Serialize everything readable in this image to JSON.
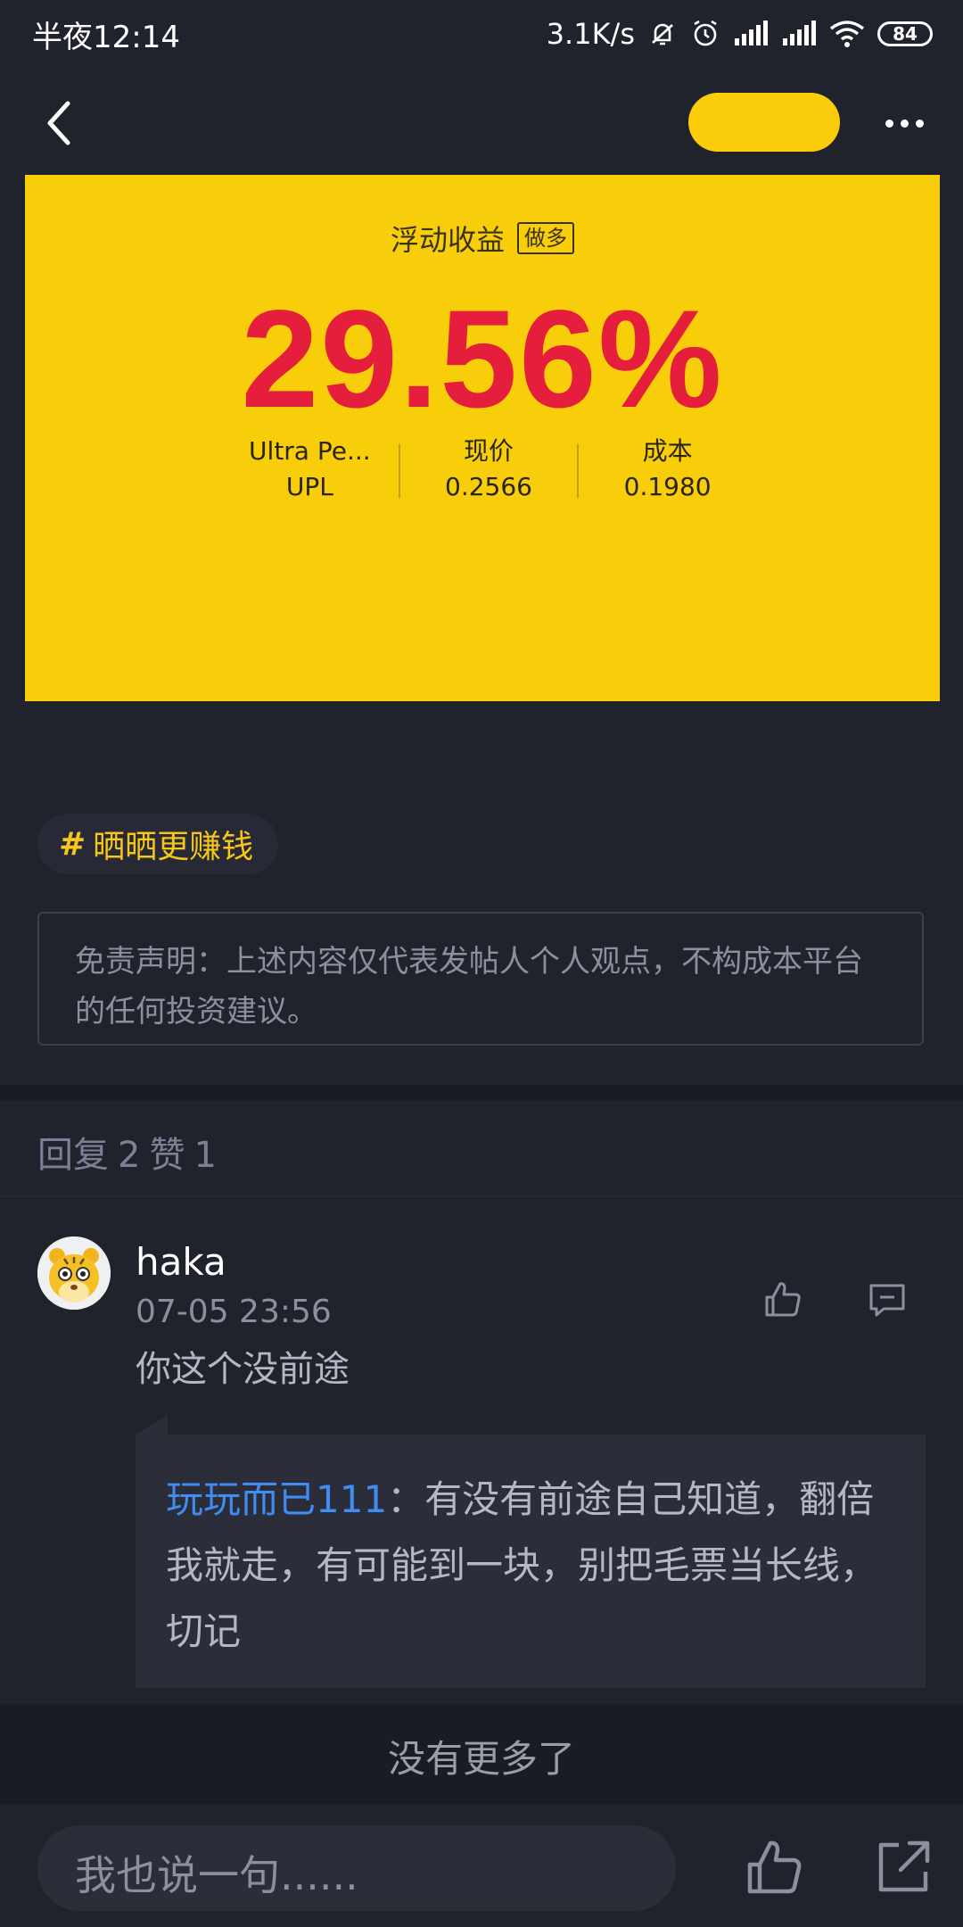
{
  "status_bar": {
    "time": "半夜12:14",
    "network_speed": "3.1K/s",
    "battery": "84"
  },
  "card": {
    "label": "浮动收益",
    "tag": "做多",
    "return_value": "29.56%",
    "stats": [
      {
        "line1": "Ultra Pe...",
        "line2": "UPL"
      },
      {
        "line1": "现价",
        "line2": "0.2566"
      },
      {
        "line1": "成本",
        "line2": "0.1980"
      }
    ]
  },
  "hashtag": {
    "symbol": "#",
    "text": "晒晒更赚钱"
  },
  "disclaimer": "免责声明：上述内容仅代表发帖人个人观点，不构成本平台的任何投资建议。",
  "post_stats": {
    "reply_label": "回复",
    "reply_count": "2",
    "like_label": "赞",
    "like_count": "1"
  },
  "comment": {
    "username": "haka",
    "time": "07-05 23:56",
    "text": "你这个没前途",
    "reply": {
      "user": "玩玩而已111",
      "text": "：有没有前途自己知道，翻倍我就走，有可能到一块，别把毛票当长线，切记"
    }
  },
  "footer": {
    "no_more": "没有更多了"
  },
  "input": {
    "placeholder": "我也说一句......"
  },
  "colors": {
    "background": "#20222c",
    "card_yellow": "#f8cd09",
    "return_red": "#e61e3e",
    "link_blue": "#3f8cf2",
    "hashtag_yellow": "#f6c618"
  }
}
